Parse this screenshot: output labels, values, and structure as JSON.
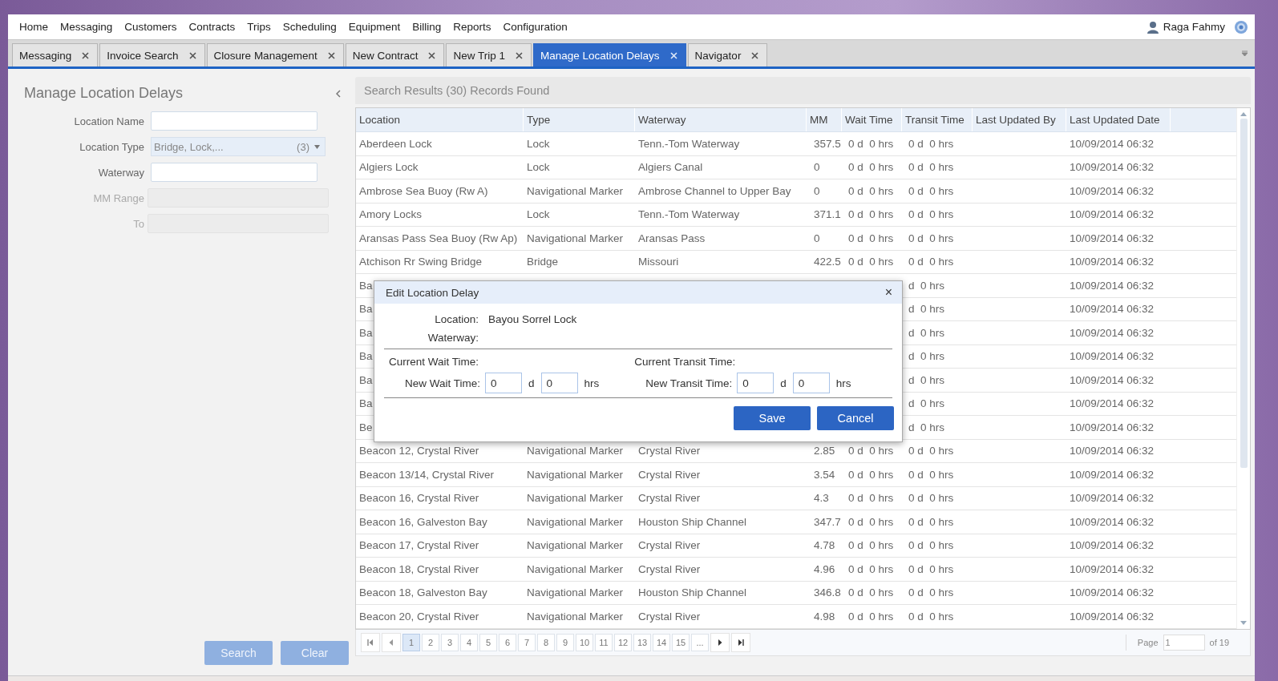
{
  "menu": {
    "items": [
      "Home",
      "Messaging",
      "Customers",
      "Contracts",
      "Trips",
      "Scheduling",
      "Equipment",
      "Billing",
      "Reports",
      "Configuration"
    ],
    "user": "Raga Fahmy"
  },
  "tabs": [
    {
      "label": "Messaging",
      "selected": false
    },
    {
      "label": "Invoice Search",
      "selected": false
    },
    {
      "label": "Closure Management",
      "selected": false
    },
    {
      "label": "New Contract",
      "selected": false
    },
    {
      "label": "New Trip 1",
      "selected": false
    },
    {
      "label": "Manage Location Delays",
      "selected": true
    },
    {
      "label": "Navigator",
      "selected": false
    }
  ],
  "search_panel": {
    "title": "Manage Location Delays",
    "fields": [
      {
        "label": "Location Name",
        "kind": "text"
      },
      {
        "label": "Location Type",
        "kind": "select",
        "value": "Bridge, Lock,...",
        "count": "(3)"
      },
      {
        "label": "Waterway",
        "kind": "text"
      },
      {
        "label": "MM Range",
        "kind": "disabled"
      },
      {
        "label": "To",
        "kind": "disabled"
      }
    ],
    "buttons": [
      {
        "label": "Search",
        "disabled": true
      },
      {
        "label": "Clear",
        "disabled": true
      }
    ]
  },
  "results": {
    "title": "Search Results (30) Records Found",
    "columns": [
      "Location",
      "Type",
      "Waterway",
      "MM",
      "Wait Time",
      "Transit Time",
      "Last Updated By",
      "Last Updated Date"
    ],
    "rows": [
      {
        "location": "Aberdeen Lock",
        "type": "Lock",
        "waterway": "Tenn.-Tom Waterway",
        "mm": "357.5",
        "wait_time": "0 d  0 hrs",
        "transit_time": "0 d  0 hrs",
        "updated_date": "10/09/2014 06:32"
      },
      {
        "location": "Algiers Lock",
        "type": "Lock",
        "waterway": "Algiers Canal",
        "mm": "0",
        "wait_time": "0 d  0 hrs",
        "transit_time": "0 d  0 hrs",
        "updated_date": "10/09/2014 06:32"
      },
      {
        "location": "Ambrose Sea Buoy (Rw A)",
        "type": "Navigational Marker",
        "waterway": "Ambrose Channel to Upper Bay",
        "mm": "0",
        "wait_time": "0 d  0 hrs",
        "transit_time": "0 d  0 hrs",
        "updated_date": "10/09/2014 06:32"
      },
      {
        "location": "Amory Locks",
        "type": "Lock",
        "waterway": "Tenn.-Tom Waterway",
        "mm": "371.1",
        "wait_time": "0 d  0 hrs",
        "transit_time": "0 d  0 hrs",
        "updated_date": "10/09/2014 06:32"
      },
      {
        "location": "Aransas Pass Sea Buoy (Rw Ap)",
        "type": "Navigational Marker",
        "waterway": "Aransas Pass",
        "mm": "0",
        "wait_time": "0 d  0 hrs",
        "transit_time": "0 d  0 hrs",
        "updated_date": "10/09/2014 06:32"
      },
      {
        "location": "Atchison Rr Swing Bridge",
        "type": "Bridge",
        "waterway": "Missouri",
        "mm": "422.5",
        "wait_time": "0 d  0 hrs",
        "transit_time": "0 d  0 hrs",
        "updated_date": "10/09/2014 06:32"
      },
      {
        "location": "Ba",
        "transit_time": "d  0 hrs",
        "updated_date": "10/09/2014 06:32"
      },
      {
        "location": "Ba",
        "transit_time": "d  0 hrs",
        "updated_date": "10/09/2014 06:32"
      },
      {
        "location": "Ba",
        "transit_time": "d  0 hrs",
        "updated_date": "10/09/2014 06:32"
      },
      {
        "location": "Ba",
        "transit_time": "d  0 hrs",
        "updated_date": "10/09/2014 06:32"
      },
      {
        "location": "Ba",
        "transit_time": "d  0 hrs",
        "updated_date": "10/09/2014 06:32"
      },
      {
        "location": "Ba",
        "transit_time": "d  0 hrs",
        "updated_date": "10/09/2014 06:32"
      },
      {
        "location": "Be",
        "transit_time": "d  0 hrs",
        "updated_date": "10/09/2014 06:32"
      },
      {
        "location": "Beacon 12, Crystal River",
        "type": "Navigational Marker",
        "waterway": "Crystal River",
        "mm": "2.85",
        "wait_time": "0 d  0 hrs",
        "transit_time": "0 d  0 hrs",
        "updated_date": "10/09/2014 06:32"
      },
      {
        "location": "Beacon 13/14, Crystal River",
        "type": "Navigational Marker",
        "waterway": "Crystal River",
        "mm": "3.54",
        "wait_time": "0 d  0 hrs",
        "transit_time": "0 d  0 hrs",
        "updated_date": "10/09/2014 06:32"
      },
      {
        "location": "Beacon 16, Crystal River",
        "type": "Navigational Marker",
        "waterway": "Crystal River",
        "mm": "4.3",
        "wait_time": "0 d  0 hrs",
        "transit_time": "0 d  0 hrs",
        "updated_date": "10/09/2014 06:32"
      },
      {
        "location": "Beacon 16, Galveston Bay",
        "type": "Navigational Marker",
        "waterway": "Houston Ship Channel",
        "mm": "347.7",
        "wait_time": "0 d  0 hrs",
        "transit_time": "0 d  0 hrs",
        "updated_date": "10/09/2014 06:32"
      },
      {
        "location": "Beacon 17, Crystal River",
        "type": "Navigational Marker",
        "waterway": "Crystal River",
        "mm": "4.78",
        "wait_time": "0 d  0 hrs",
        "transit_time": "0 d  0 hrs",
        "updated_date": "10/09/2014 06:32"
      },
      {
        "location": "Beacon 18, Crystal River",
        "type": "Navigational Marker",
        "waterway": "Crystal River",
        "mm": "4.96",
        "wait_time": "0 d  0 hrs",
        "transit_time": "0 d  0 hrs",
        "updated_date": "10/09/2014 06:32"
      },
      {
        "location": "Beacon 18, Galveston Bay",
        "type": "Navigational Marker",
        "waterway": "Houston Ship Channel",
        "mm": "346.8",
        "wait_time": "0 d  0 hrs",
        "transit_time": "0 d  0 hrs",
        "updated_date": "10/09/2014 06:32"
      },
      {
        "location": "Beacon 20, Crystal River",
        "type": "Navigational Marker",
        "waterway": "Crystal River",
        "mm": "4.98",
        "wait_time": "0 d  0 hrs",
        "transit_time": "0 d  0 hrs",
        "updated_date": "10/09/2014 06:32"
      }
    ],
    "pager": {
      "pages": [
        {
          "label": "1",
          "selected": true
        },
        {
          "label": "2",
          "selected": false
        },
        {
          "label": "3",
          "selected": false
        },
        {
          "label": "4",
          "selected": false
        },
        {
          "label": "5",
          "selected": false
        },
        {
          "label": "6",
          "selected": false
        },
        {
          "label": "7",
          "selected": false
        },
        {
          "label": "8",
          "selected": false
        },
        {
          "label": "9",
          "selected": false
        },
        {
          "label": "10",
          "selected": false
        },
        {
          "label": "11",
          "selected": false
        },
        {
          "label": "12",
          "selected": false
        },
        {
          "label": "13",
          "selected": false
        },
        {
          "label": "14",
          "selected": false
        },
        {
          "label": "15",
          "selected": false
        },
        {
          "label": "...",
          "selected": false
        }
      ],
      "page_label": "Page",
      "page_value": "1",
      "page_total": "of 19"
    }
  },
  "dialog": {
    "title": "Edit Location Delay",
    "close": "×",
    "location_label": "Location:",
    "location_value": "Bayou Sorrel Lock",
    "waterway_label": "Waterway:",
    "current_wait_label": "Current Wait Time:",
    "current_transit_label": "Current Transit Time:",
    "new_wait": {
      "label": "New Wait Time:",
      "days": "0",
      "days_unit": "d",
      "hours": "0",
      "hours_unit": "hrs"
    },
    "new_transit": {
      "label": "New Transit Time:",
      "days": "0",
      "days_unit": "d",
      "hours": "0",
      "hours_unit": "hrs"
    },
    "buttons": [
      "Save",
      "Cancel"
    ]
  }
}
